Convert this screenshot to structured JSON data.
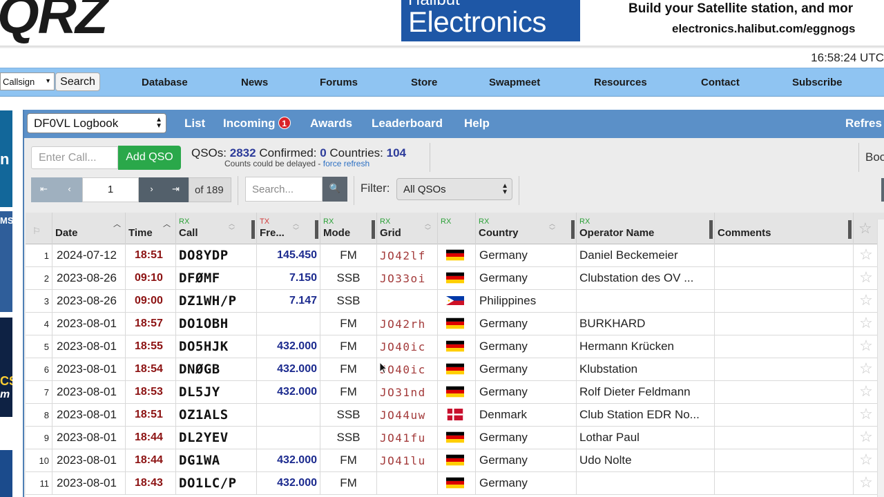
{
  "site": {
    "logo_text": "QRZ",
    "clock": "16:58:24 UTC"
  },
  "ad": {
    "brand_line1": "Halibut",
    "brand_line2": "Electronics",
    "tagline": "Build your Satellite station, and mor",
    "url": "electronics.halibut.com/eggnogs"
  },
  "nav": {
    "callsign_select": "Callsign",
    "search_button": "Search",
    "items": [
      "Database",
      "News",
      "Forums",
      "Store",
      "Swapmeet",
      "Resources",
      "Contact",
      "Subscribe"
    ]
  },
  "left_ads": {
    "ad1_text": "n",
    "ad2_text": "MS",
    "ad3_text": "CS",
    "ad3_sub": "m"
  },
  "logbook": {
    "selected_logbook": "DF0VL Logbook",
    "links": {
      "list": "List",
      "incoming": "Incoming",
      "incoming_badge": "1",
      "awards": "Awards",
      "leaderboard": "Leaderboard",
      "help": "Help",
      "refresh": "Refres"
    },
    "call_placeholder": "Enter Call...",
    "add_qso": "Add QSO",
    "stats": {
      "qsos_label": "QSOs:",
      "qsos": "2832",
      "confirmed_label": "Confirmed:",
      "confirmed": "0",
      "countries_label": "Countries:",
      "countries": "104",
      "note": "Counts could be delayed - ",
      "force_refresh": "force refresh"
    },
    "right_cut": "Boo",
    "pagination": {
      "first": "⇤",
      "prev": "‹",
      "page": "1",
      "next": "›",
      "last": "⇥",
      "of_pages": "of 189"
    },
    "search_placeholder": "Search...",
    "search_icon": "🔍",
    "filter_label": "Filter:",
    "filter_value": "All QSOs"
  },
  "table": {
    "headers": {
      "rownum_icon": "flag-icon",
      "date": "Date",
      "time": "Time",
      "call_tag": "RX",
      "call": "Call",
      "freq_tag": "TX",
      "freq": "Fre...",
      "mode_tag": "RX",
      "mode": "Mode",
      "grid_tag": "RX",
      "grid": "Grid",
      "flag_tag": "RX",
      "country_tag": "RX",
      "country": "Country",
      "op_tag": "RX",
      "op": "Operator Name",
      "comments": "Comments",
      "star": "☆"
    },
    "rows": [
      {
        "n": "1",
        "date": "2024-07-12",
        "time": "18:51",
        "call": "DO8YDP",
        "freq": "145.450",
        "mode": "FM",
        "grid": "JO42lf",
        "flag": "de",
        "country": "Germany",
        "op": "Daniel Beckemeier"
      },
      {
        "n": "2",
        "date": "2023-08-26",
        "time": "09:10",
        "call": "DFØMF",
        "freq": "7.150",
        "mode": "SSB",
        "grid": "JO33oi",
        "flag": "de",
        "country": "Germany",
        "op": "Clubstation des OV ..."
      },
      {
        "n": "3",
        "date": "2023-08-26",
        "time": "09:00",
        "call": "DZ1WH/P",
        "freq": "7.147",
        "mode": "SSB",
        "grid": "",
        "flag": "ph",
        "country": "Philippines",
        "op": ""
      },
      {
        "n": "4",
        "date": "2023-08-01",
        "time": "18:57",
        "call": "DO1OBH",
        "freq": "",
        "mode": "FM",
        "grid": "JO42rh",
        "flag": "de",
        "country": "Germany",
        "op": "BURKHARD"
      },
      {
        "n": "5",
        "date": "2023-08-01",
        "time": "18:55",
        "call": "DO5HJK",
        "freq": "432.000",
        "mode": "FM",
        "grid": "JO40ic",
        "flag": "de",
        "country": "Germany",
        "op": "Hermann Krücken"
      },
      {
        "n": "6",
        "date": "2023-08-01",
        "time": "18:54",
        "call": "DNØGB",
        "freq": "432.000",
        "mode": "FM",
        "grid": "JO40ic",
        "flag": "de",
        "country": "Germany",
        "op": "Klubstation"
      },
      {
        "n": "7",
        "date": "2023-08-01",
        "time": "18:53",
        "call": "DL5JY",
        "freq": "432.000",
        "mode": "FM",
        "grid": "JO31nd",
        "flag": "de",
        "country": "Germany",
        "op": "Rolf Dieter Feldmann"
      },
      {
        "n": "8",
        "date": "2023-08-01",
        "time": "18:51",
        "call": "OZ1ALS",
        "freq": "",
        "mode": "SSB",
        "grid": "JO44uw",
        "flag": "dk",
        "country": "Denmark",
        "op": "Club Station EDR No..."
      },
      {
        "n": "9",
        "date": "2023-08-01",
        "time": "18:44",
        "call": "DL2YEV",
        "freq": "",
        "mode": "SSB",
        "grid": "JO41fu",
        "flag": "de",
        "country": "Germany",
        "op": "Lothar Paul"
      },
      {
        "n": "10",
        "date": "2023-08-01",
        "time": "18:44",
        "call": "DG1WA",
        "freq": "432.000",
        "mode": "FM",
        "grid": "JO41lu",
        "flag": "de",
        "country": "Germany",
        "op": "Udo Nolte"
      },
      {
        "n": "11",
        "date": "2023-08-01",
        "time": "18:43",
        "call": "DO1LC/P",
        "freq": "432.000",
        "mode": "FM",
        "grid": "",
        "flag": "de",
        "country": "Germany",
        "op": ""
      }
    ]
  },
  "colors": {
    "nav_bg": "#8fc4f2",
    "logbook_bar": "#5b90c8",
    "add_qso": "#2aa84a",
    "time_text": "#8c1212",
    "freq_text": "#1b2a8e",
    "grid_text": "#a33a3a"
  }
}
